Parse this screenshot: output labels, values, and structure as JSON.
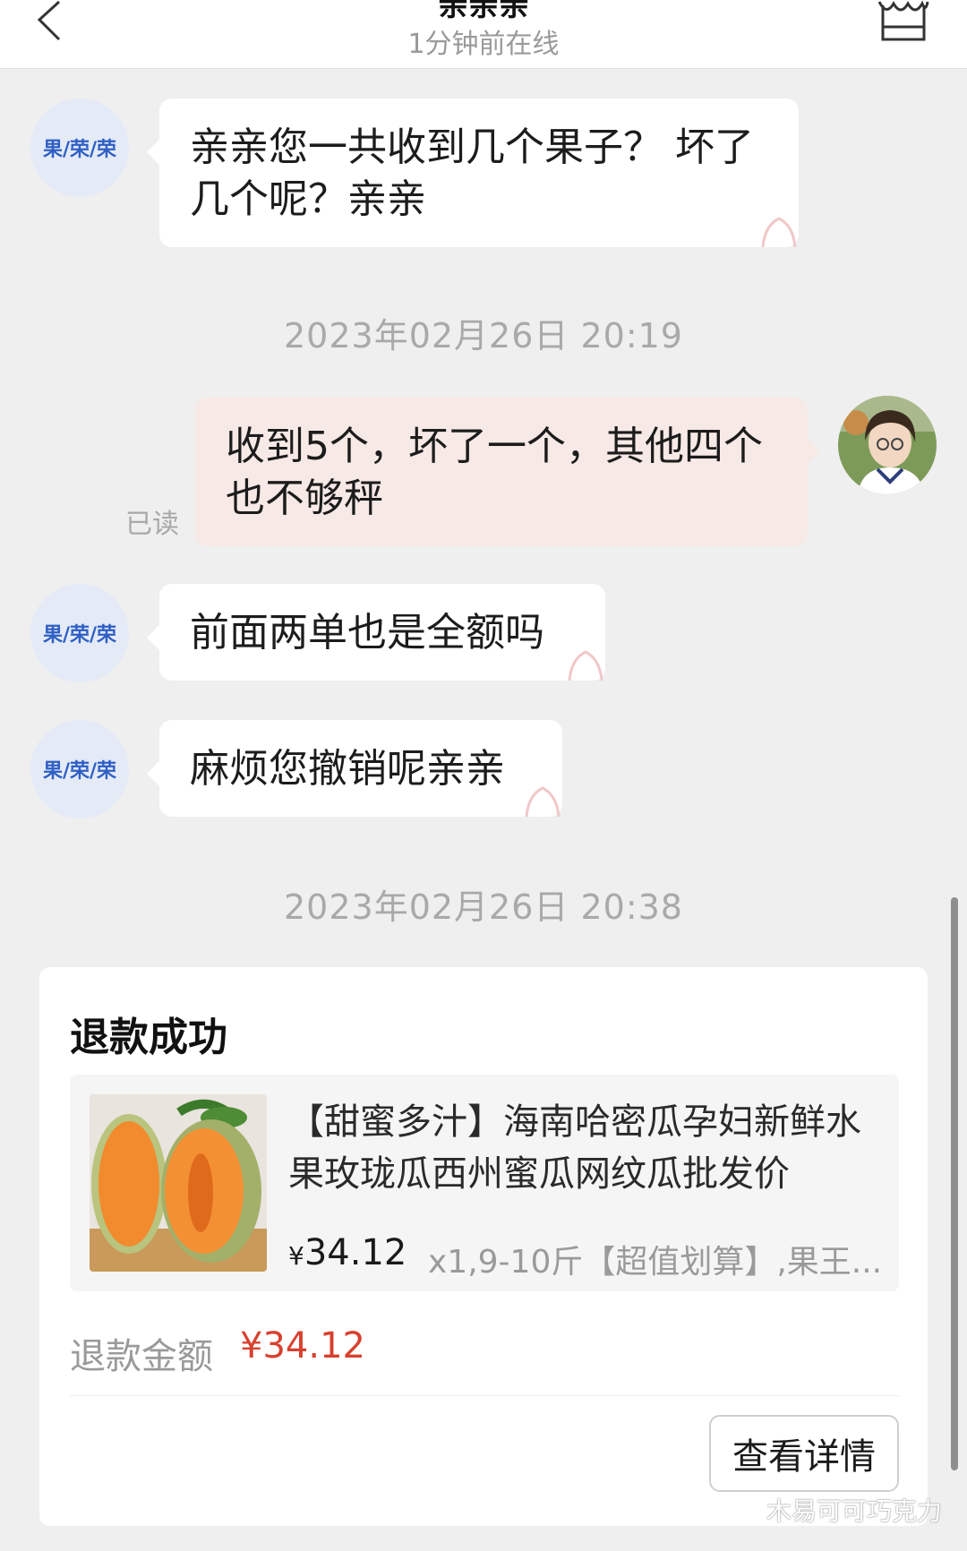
{
  "header": {
    "title": "亲亲亲",
    "status": "1分钟前在线"
  },
  "shop_avatar_label": "果/荣/荣",
  "messages": [
    {
      "text": "亲亲您一共收到几个果子？  坏了几个呢？亲亲"
    },
    {
      "text": "收到5个，坏了一个，其他四个也不够秤",
      "read_label": "已读"
    },
    {
      "text": "前面两单也是全额吗"
    },
    {
      "text": "麻烦您撤销呢亲亲"
    }
  ],
  "timestamps": [
    "2023年02月26日 20:19",
    "2023年02月26日 20:38"
  ],
  "refund_card": {
    "title": "退款成功",
    "product": {
      "title": "【甜蜜多汁】海南哈密瓜孕妇新鲜水果玫珑瓜西州蜜瓜网纹瓜批发价",
      "currency": "¥",
      "price": "34.12",
      "spec": "x1,9-10斤【超值划算】,果王..."
    },
    "refund_label": "退款金额",
    "refund_amount": "¥34.12",
    "detail_button": "查看详情"
  },
  "watermark": "木易可可巧克力",
  "colors": {
    "background": "#efefef",
    "outgoing_bubble": "#f7e9e6",
    "refund_amount": "#d8402e",
    "shop_avatar_text": "#2f5fc4"
  }
}
